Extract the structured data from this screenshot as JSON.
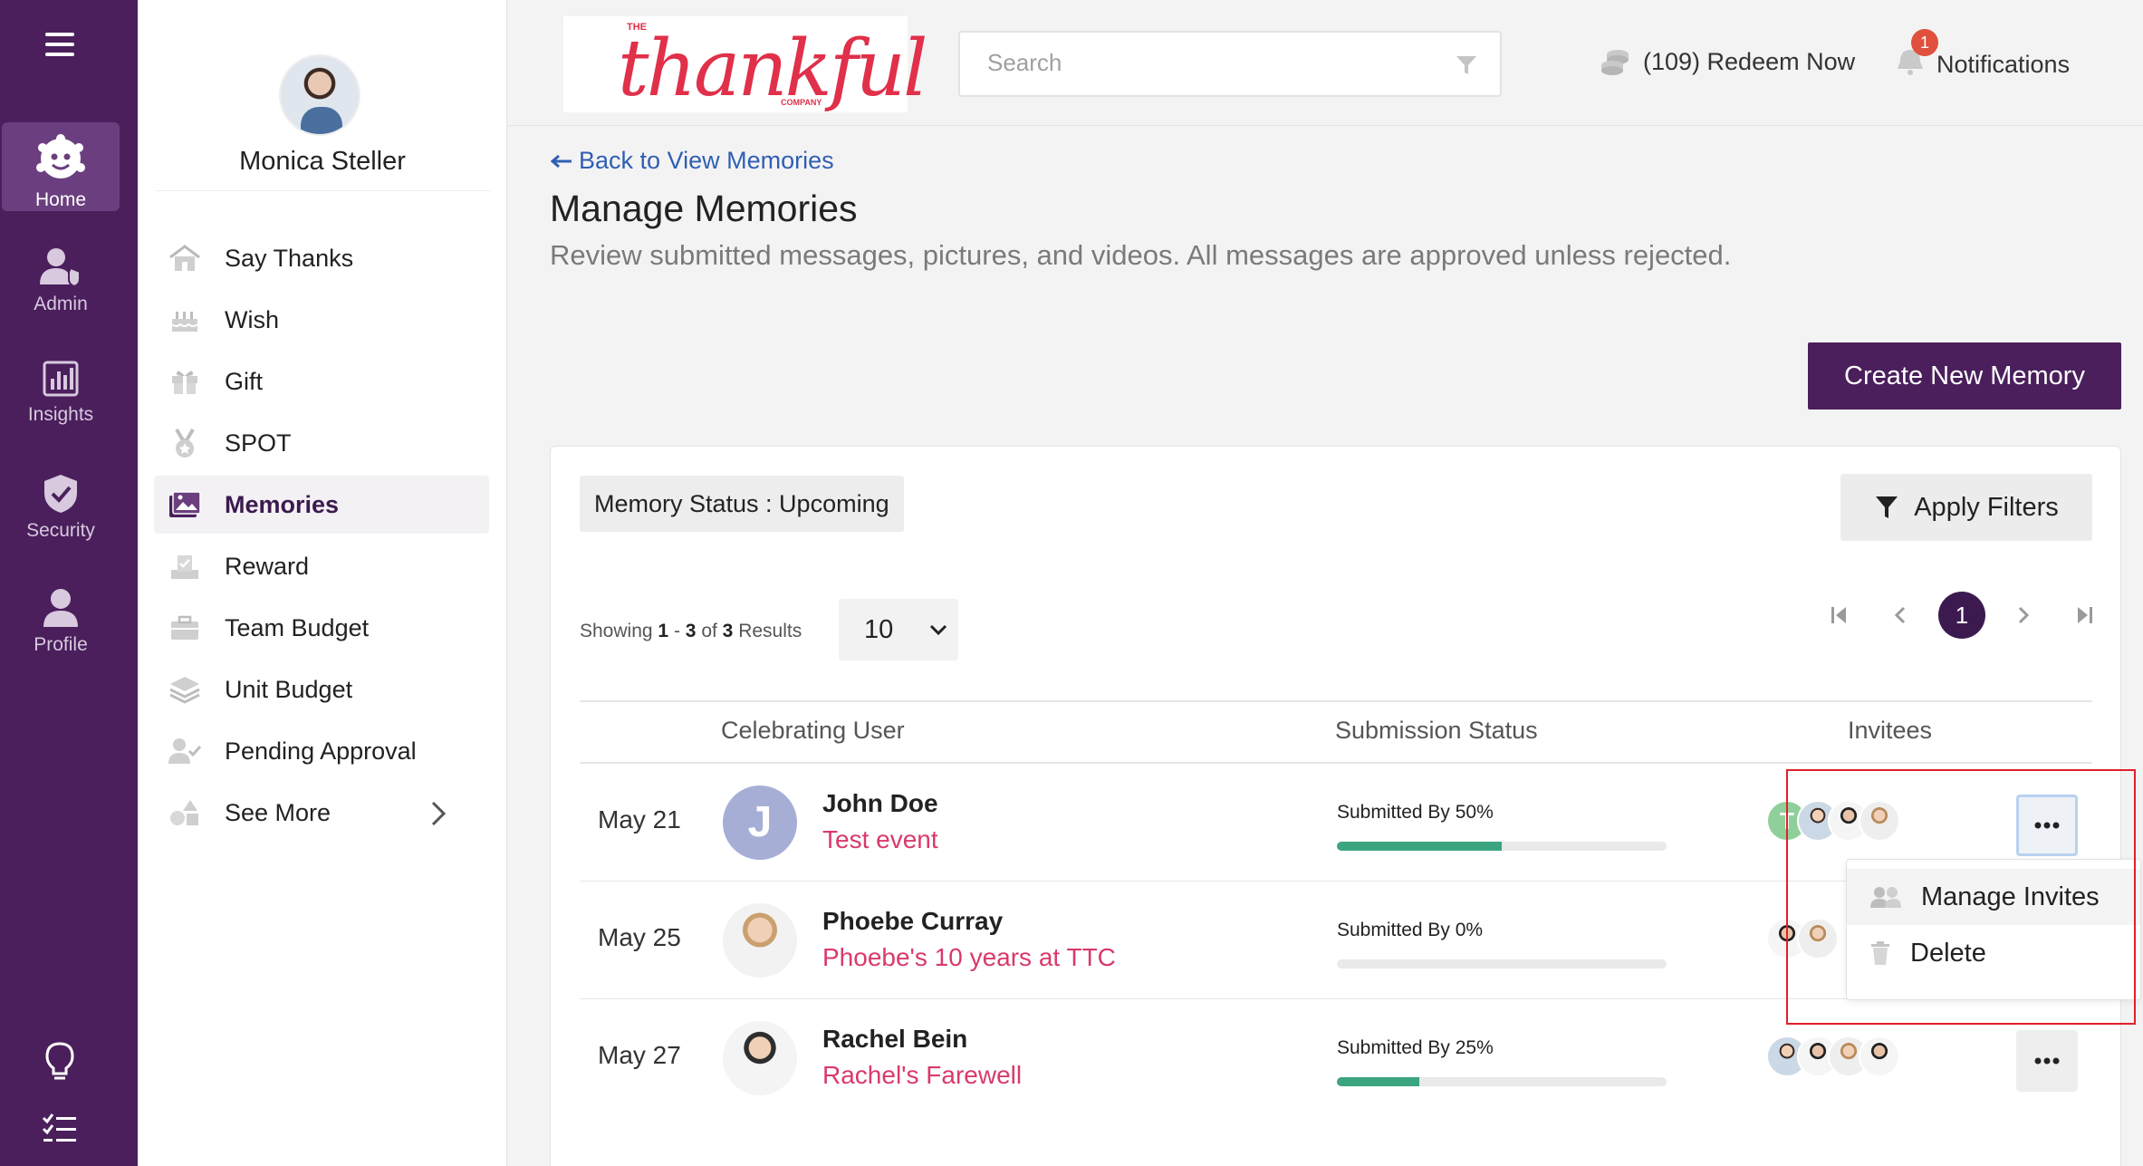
{
  "rail": {
    "items": [
      {
        "label": "Home",
        "icon": "home-bot-icon",
        "active": true
      },
      {
        "label": "Admin",
        "icon": "admin-icon"
      },
      {
        "label": "Insights",
        "icon": "insights-icon"
      },
      {
        "label": "Security",
        "icon": "shield-icon"
      },
      {
        "label": "Profile",
        "icon": "profile-icon"
      }
    ]
  },
  "sidebar": {
    "user_name": "Monica Steller",
    "items": [
      {
        "label": "Say Thanks",
        "icon": "house-icon"
      },
      {
        "label": "Wish",
        "icon": "cake-icon"
      },
      {
        "label": "Gift",
        "icon": "gift-icon"
      },
      {
        "label": "SPOT",
        "icon": "medal-icon"
      },
      {
        "label": "Memories",
        "icon": "photos-icon",
        "active": true
      },
      {
        "label": "Reward",
        "icon": "reward-icon"
      },
      {
        "label": "Team Budget",
        "icon": "briefcase-icon"
      },
      {
        "label": "Unit Budget",
        "icon": "layers-icon"
      },
      {
        "label": "Pending Approval",
        "icon": "user-check-icon"
      },
      {
        "label": "See More",
        "icon": "shapes-icon"
      }
    ]
  },
  "header": {
    "logo_text": "thankful",
    "logo_small_top": "THE",
    "logo_small_bottom": "COMPANY",
    "search_placeholder": "Search",
    "redeem_label": "(109) Redeem Now",
    "notifications_label": "Notifications",
    "notifications_count": "1"
  },
  "page": {
    "back_link": "Back to View Memories",
    "title": "Manage Memories",
    "subtitle": "Review submitted messages, pictures, and videos. All messages are approved unless rejected.",
    "create_button": "Create New Memory"
  },
  "filters": {
    "status_chip": "Memory Status : Upcoming",
    "apply_button": "Apply Filters"
  },
  "pagination": {
    "showing_prefix": "Showing",
    "range_start": "1",
    "range_sep": "-",
    "range_end": "3",
    "of_label": "of",
    "total": "3",
    "results_label": "Results",
    "page_size": "10",
    "current_page": "1"
  },
  "table": {
    "headers": [
      "Celebrating User",
      "Submission Status",
      "Invitees"
    ],
    "rows": [
      {
        "date": "May 21",
        "name": "John Doe",
        "event": "Test event",
        "status": "Submitted By 50%",
        "progress": 0.5
      },
      {
        "date": "May 25",
        "name": "Phoebe Curray",
        "event": "Phoebe's 10 years at TTC",
        "status": "Submitted By 0%",
        "progress": 0
      },
      {
        "date": "May 27",
        "name": "Rachel Bein",
        "event": "Rachel's Farewell",
        "status": "Submitted By 25%",
        "progress": 0.25
      }
    ],
    "first_row_avatar_initial": "J",
    "first_invitee_initial": "T"
  },
  "context_menu": {
    "items": [
      "Manage Invites",
      "Delete"
    ]
  },
  "colors": {
    "brand_purple": "#4a1f5c",
    "accent_pink": "#d93a6a",
    "progress_green": "#3aa57f",
    "link_blue": "#2f5fb3"
  }
}
